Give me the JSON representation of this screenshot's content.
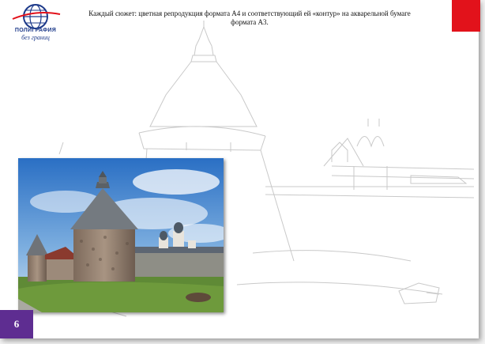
{
  "logo": {
    "line1": "ПОЛИГРАФИЯ",
    "line2": "без границ"
  },
  "caption": {
    "line1": "Каждый сюжет: цветная репродукция формата А4 и соответствующий ей   «контур» на акварельной бумаге",
    "line2": "формата А3."
  },
  "page_number": "6",
  "colors": {
    "corner_tab": "#e2121b",
    "page_badge": "#5e2d91",
    "logo": "#1d3a8a"
  },
  "icons": {
    "logo": "globe-icon"
  }
}
